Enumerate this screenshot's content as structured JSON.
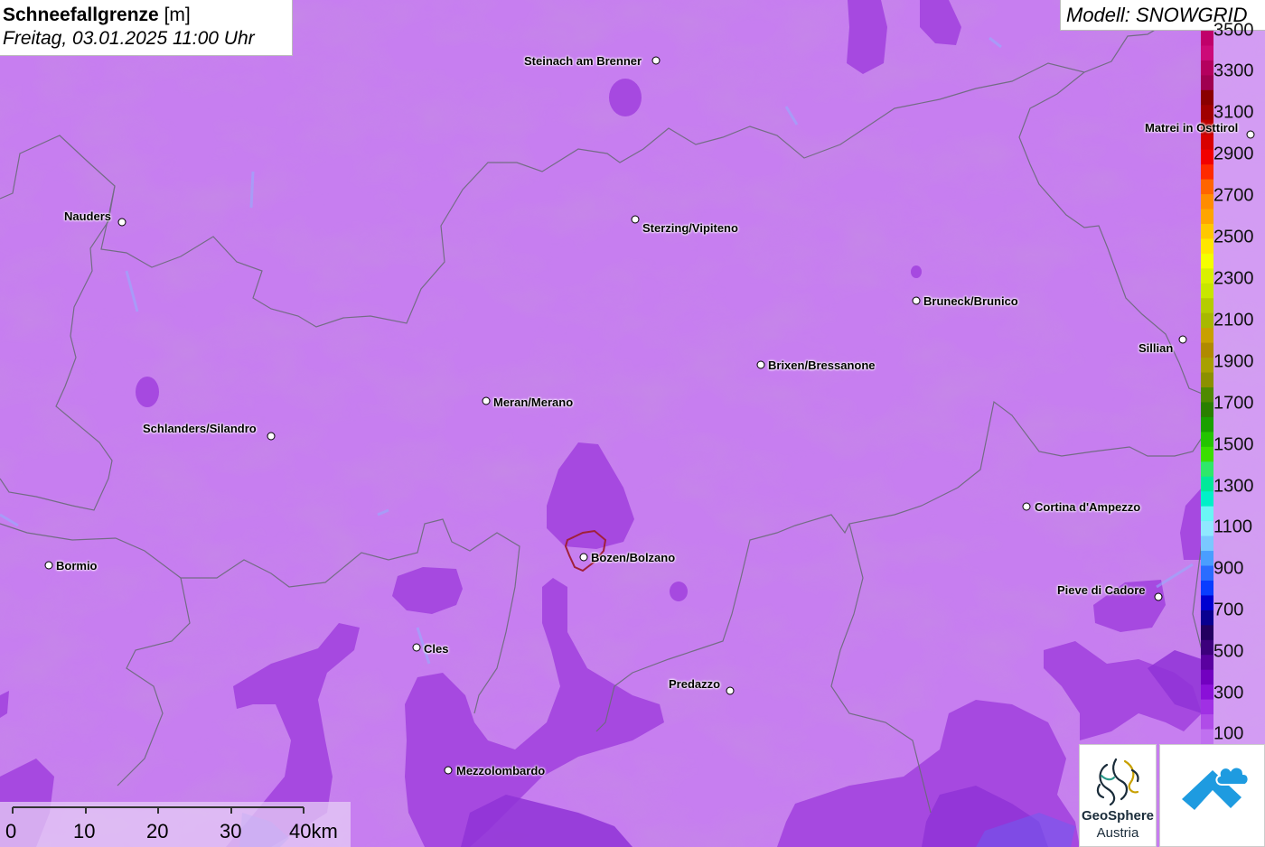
{
  "header": {
    "title_bold": "Schneefallgrenze",
    "title_unit": " [m]",
    "datetime": "Freitag, 03.01.2025 11:00 Uhr"
  },
  "model": {
    "label": "Modell: SNOWGRID"
  },
  "legend": {
    "labels": [
      "3500",
      "3300",
      "3100",
      "2900",
      "2700",
      "2500",
      "2300",
      "2100",
      "1900",
      "1700",
      "1500",
      "1300",
      "1100",
      "900",
      "700",
      "500",
      "300",
      "100"
    ],
    "colors": [
      "#c0006a",
      "#cc0a78",
      "#b4005e",
      "#a00050",
      "#8a0000",
      "#a00000",
      "#bd0000",
      "#d80000",
      "#f20000",
      "#ff2a00",
      "#ff6400",
      "#ff8c00",
      "#ffa500",
      "#ffc800",
      "#ffe600",
      "#f5ff00",
      "#d9f000",
      "#c8e600",
      "#b5cc00",
      "#a8b800",
      "#c8a000",
      "#b08a00",
      "#a8a000",
      "#8c9000",
      "#4f8a00",
      "#2a7f00",
      "#1aa000",
      "#24c400",
      "#3ade00",
      "#2ee86a",
      "#00e89a",
      "#00f0c8",
      "#6af5f5",
      "#90e8ff",
      "#7ac8ff",
      "#4a9eff",
      "#2a6cff",
      "#0a3cff",
      "#0000d0",
      "#0a0090",
      "#220060",
      "#3c007c",
      "#5a00a0",
      "#7200c0",
      "#8a10d8",
      "#a030e4",
      "#b04ce8",
      "#c070f0"
    ]
  },
  "places": [
    {
      "name": "Steinach am Brenner"
    },
    {
      "name": "Matrei in Osttirol"
    },
    {
      "name": "Nauders"
    },
    {
      "name": "Sterzing/Vipiteno"
    },
    {
      "name": "Bruneck/Brunico"
    },
    {
      "name": "Sillian"
    },
    {
      "name": "Brixen/Bressanone"
    },
    {
      "name": "Meran/Merano"
    },
    {
      "name": "Schlanders/Silandro"
    },
    {
      "name": "Cortina d'Ampezzo"
    },
    {
      "name": "Bormio"
    },
    {
      "name": "Bozen/Bolzano"
    },
    {
      "name": "Pieve di Cadore"
    },
    {
      "name": "Cles"
    },
    {
      "name": "Predazzo"
    },
    {
      "name": "Mezzolombardo"
    }
  ],
  "scale": {
    "labels": [
      "0",
      "10",
      "20",
      "30",
      "40km"
    ]
  },
  "logos": {
    "geosphere_line1": "GeoSphere",
    "geosphere_line2": "Austria"
  },
  "colors": {
    "map_base": "#c77ef0",
    "map_dark": "#9a3ad8",
    "map_darker": "#8a2ad0",
    "border": "#6a6a7a",
    "bolzano_outline": "#a0203a"
  }
}
